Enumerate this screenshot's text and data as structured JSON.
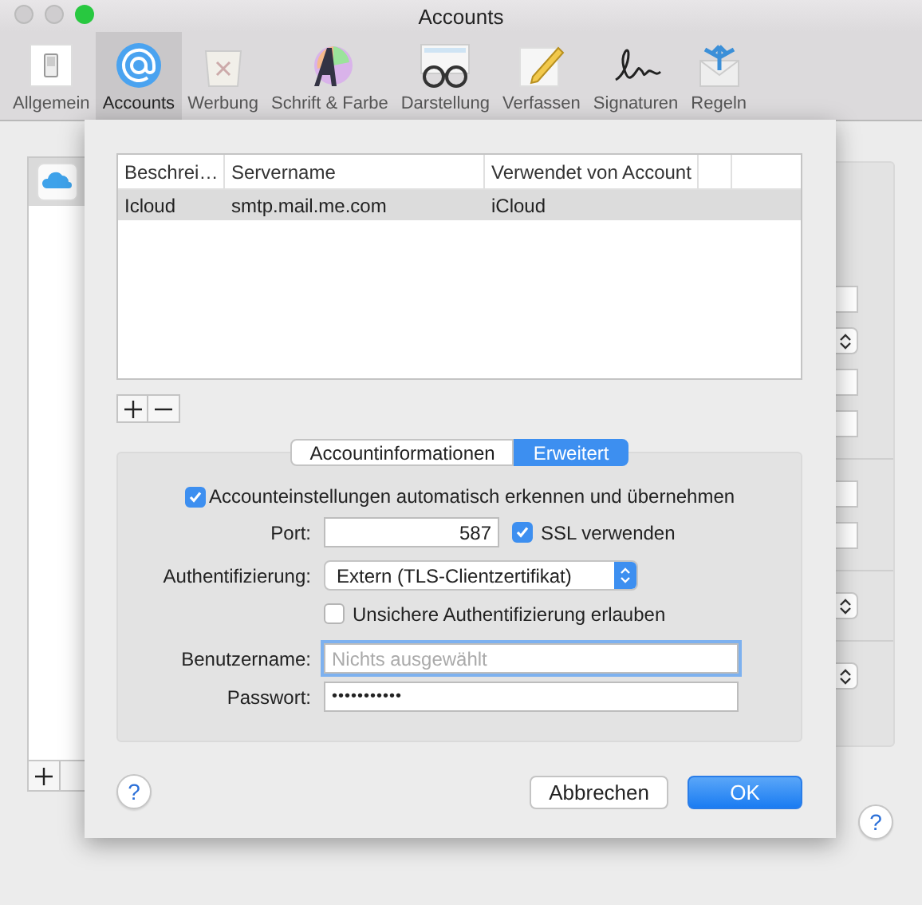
{
  "window": {
    "title": "Accounts"
  },
  "toolbar": [
    {
      "label": "Allgemein",
      "selected": false
    },
    {
      "label": "Accounts",
      "selected": true
    },
    {
      "label": "Werbung",
      "selected": false
    },
    {
      "label": "Schrift & Farbe",
      "selected": false
    },
    {
      "label": "Darstellung",
      "selected": false
    },
    {
      "label": "Verfassen",
      "selected": false
    },
    {
      "label": "Signaturen",
      "selected": false
    },
    {
      "label": "Regeln",
      "selected": false
    }
  ],
  "background_help": "?",
  "sheet": {
    "table": {
      "columns": [
        "Beschrei…",
        "Servername",
        "Verwendet von Account"
      ],
      "rows": [
        {
          "cells": [
            "Icloud",
            "smtp.mail.me.com",
            "iCloud"
          ],
          "selected": true
        }
      ]
    },
    "tabs": [
      {
        "label": "Accountinformationen",
        "selected": false
      },
      {
        "label": "Erweitert",
        "selected": true
      }
    ],
    "auto_detect": {
      "label": "Accounteinstellungen automatisch erkennen und übernehmen",
      "checked": true
    },
    "port": {
      "label": "Port:",
      "value": "587"
    },
    "ssl": {
      "label": "SSL verwenden",
      "checked": true
    },
    "authentication": {
      "label": "Authentifizierung:",
      "value": "Extern (TLS-Clientzertifikat)"
    },
    "insecure": {
      "label": "Unsichere Authentifizierung erlauben",
      "checked": false
    },
    "username": {
      "label": "Benutzername:",
      "placeholder": "Nichts ausgewählt"
    },
    "password": {
      "label": "Passwort:",
      "value": "•••••••••••"
    },
    "help": "?",
    "buttons": [
      {
        "label": "Abbrechen",
        "kind": "cancel"
      },
      {
        "label": "OK",
        "kind": "default"
      }
    ]
  }
}
